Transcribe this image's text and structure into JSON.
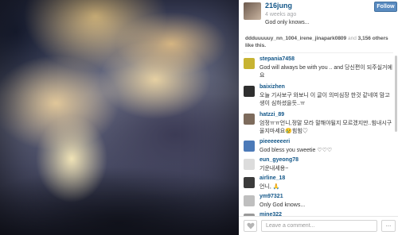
{
  "post": {
    "username": "216jung",
    "time_ago": "4 weeks ago",
    "caption": "God only knows...",
    "follow_label": "Follow"
  },
  "likes": {
    "names": "ddduuuuuy_nn_1004_irene_jinapark0809",
    "and_text": "and",
    "count_text": "3,156 others like this."
  },
  "comments": [
    {
      "user": "stepania7458",
      "text": "God will always be with you .. and 당신편이 되주실거에요",
      "avatar_color": "#c7b332"
    },
    {
      "user": "baixizhen",
      "text": "오늘 기사보구 와보니 이 글이 의미심장 한것 같네여 맘고생이 심하셨을듯..ㅠ",
      "avatar_color": "#2f2f2f"
    },
    {
      "user": "hatzzi_89",
      "text": "엄정ㅠㅠ언니,정말 모라 말해야될지 모르겠지만..힘내시구 울지마세요😢힘힘♡",
      "avatar_color": "#7d6b5c"
    },
    {
      "user": "pieeeeeeeri",
      "text": "God bless you sweetie ♡♡♡",
      "avatar_color": "#4c7ab8"
    },
    {
      "user": "eun_gyeong78",
      "text": "기운내세용~",
      "avatar_color": "#dcdcdc"
    },
    {
      "user": "airline_18",
      "text": "언니, 🙏",
      "avatar_color": "#3b3b3b"
    },
    {
      "user": "ym97321",
      "text": "Only God knows...",
      "avatar_color": "#bfbfbf"
    },
    {
      "user": "mine322",
      "text": "",
      "avatar_color": "#999999"
    }
  ],
  "footer": {
    "comment_placeholder": "Leave a comment...",
    "more_label": "..."
  },
  "icons": {
    "like": "heart-icon",
    "more": "more-options-icon"
  }
}
